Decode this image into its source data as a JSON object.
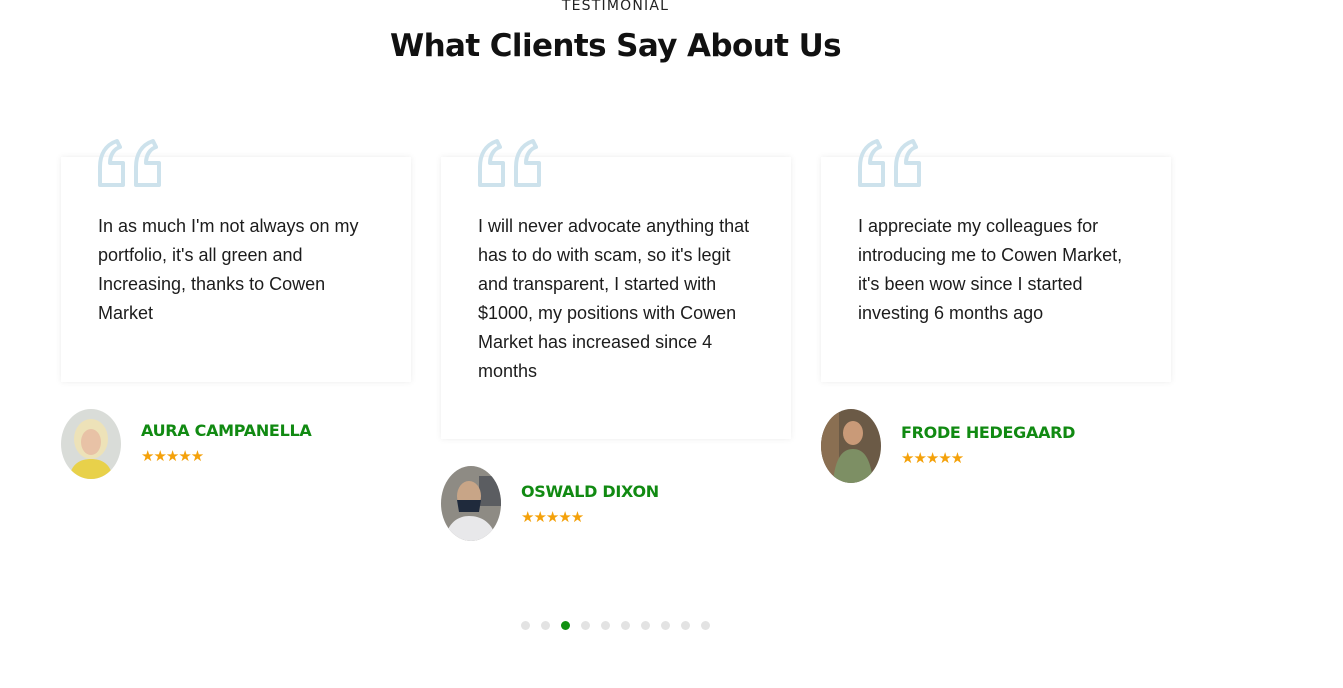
{
  "section": {
    "eyebrow": "TESTIMONIAL",
    "title": "What Clients Say About Us"
  },
  "testimonials": [
    {
      "quote": "In as much I'm not always on my portfolio, it's all green and Increasing, thanks to Cowen Market",
      "name": "AURA CAMPANELLA",
      "stars": "★★★★★",
      "rating": 5,
      "quote_icon": "quote-icon",
      "avatar_icon": "avatar-photo"
    },
    {
      "quote": "I will never advocate anything that has to do with scam, so it's legit and transparent, I started with $1000, my positions with Cowen Market has increased since 4 months",
      "name": "OSWALD DIXON",
      "stars": "★★★★★",
      "rating": 5,
      "quote_icon": "quote-icon",
      "avatar_icon": "avatar-photo"
    },
    {
      "quote": "I appreciate my colleagues for introducing me to Cowen Market, it's been wow since I started investing 6 months ago",
      "name": "FRODE HEDEGAARD",
      "stars": "★★★★★",
      "rating": 5,
      "quote_icon": "quote-icon",
      "avatar_icon": "avatar-photo"
    }
  ],
  "pagination": {
    "total": 10,
    "active_index": 2
  },
  "colors": {
    "accent_green": "#118a12",
    "star_orange": "#f4a10a",
    "quote_blue": "#cde2ec",
    "dot_inactive": "#e3e3e3",
    "dot_active": "#119111"
  }
}
